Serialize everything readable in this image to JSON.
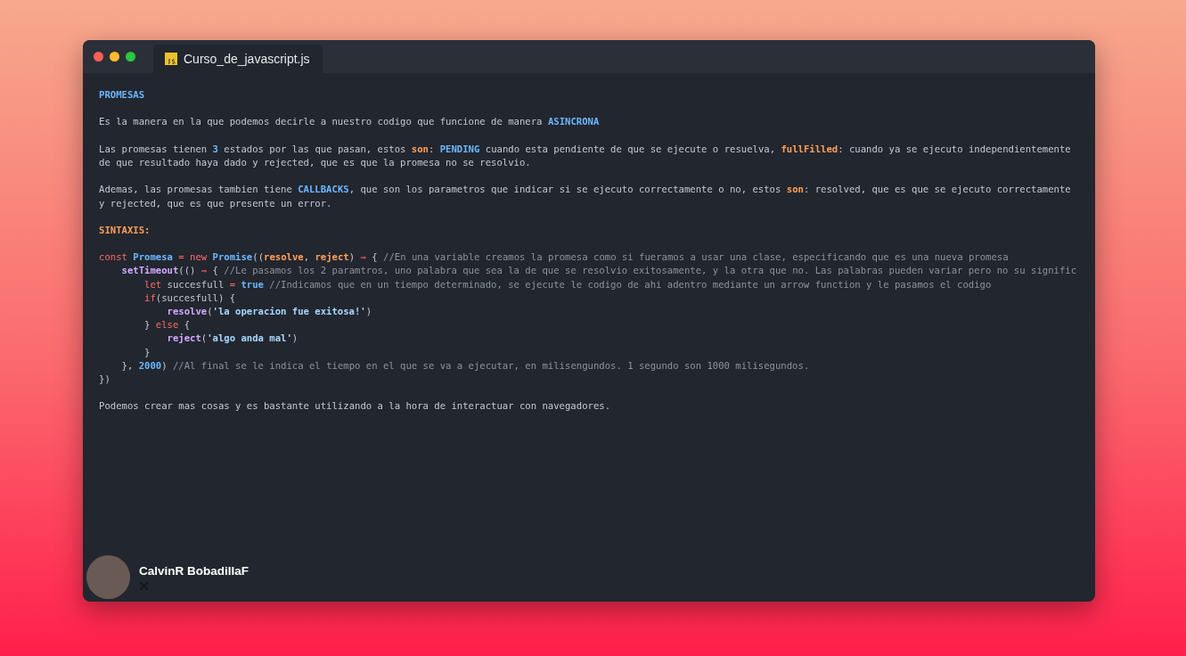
{
  "window": {
    "tab": {
      "label": "Curso_de_javascript.js",
      "selected": true
    }
  },
  "blocks": [
    {
      "lines": [
        [
          {
            "kind": "blue",
            "text": "PROMESAS"
          }
        ]
      ]
    },
    {
      "lines": [
        [
          {
            "kind": "plain",
            "text": "Es la manera en la que podemos decirle a nuestro codigo que funcione de manera "
          },
          {
            "kind": "blue",
            "text": "ASINCRONA"
          }
        ]
      ]
    },
    {
      "lines": [
        [
          {
            "kind": "plain",
            "text": "Las promesas tienen "
          },
          {
            "kind": "blue",
            "text": "3"
          },
          {
            "kind": "plain",
            "text": " estados por las que pasan, estos "
          },
          {
            "kind": "orange",
            "text": "son"
          },
          {
            "kind": "plain",
            "text": ": "
          },
          {
            "kind": "blue",
            "text": "PENDING"
          },
          {
            "kind": "plain",
            "text": " cuando esta pendiente de que se ejecute o resuelva, "
          },
          {
            "kind": "orange",
            "text": "fullFilled"
          },
          {
            "kind": "plain",
            "text": ": cuando ya se ejecuto independientemente"
          }
        ],
        [
          {
            "kind": "plain",
            "text": "de que resultado haya dado y rejected, que es que la promesa no se resolvio."
          }
        ]
      ]
    },
    {
      "lines": [
        [
          {
            "kind": "plain",
            "text": "Ademas, las promesas tambien tiene "
          },
          {
            "kind": "blue",
            "text": "CALLBACKS"
          },
          {
            "kind": "plain",
            "text": ", que son los parametros que indicar si se ejecuto correctamente o no, estos "
          },
          {
            "kind": "orange",
            "text": "son"
          },
          {
            "kind": "plain",
            "text": ": resolved, que es que se ejecuto correctamente"
          }
        ],
        [
          {
            "kind": "plain",
            "text": "y rejected, que es que presente un error."
          }
        ]
      ]
    },
    {
      "lines": [
        [
          {
            "kind": "orange",
            "text": "SINTAXIS:"
          }
        ]
      ]
    },
    {
      "code": [
        {
          "tokens": [
            {
              "kind": "keyword",
              "text": "const "
            },
            {
              "kind": "blue",
              "text": "Promesa"
            },
            {
              "kind": "keyword",
              "text": " = new "
            },
            {
              "kind": "blue",
              "text": "Promise"
            },
            {
              "kind": "plain",
              "text": "(("
            },
            {
              "kind": "orange",
              "text": "resolve"
            },
            {
              "kind": "plain",
              "text": ", "
            },
            {
              "kind": "orange",
              "text": "reject"
            },
            {
              "kind": "plain",
              "text": ") "
            },
            {
              "kind": "keyword",
              "text": "⇒"
            },
            {
              "kind": "plain",
              "text": " { "
            },
            {
              "kind": "comment",
              "text": "//En una variable creamos la promesa como si fueramos a usar una clase, especificando que es una nueva promesa"
            }
          ],
          "children": [
            {
              "tokens": [
                {
                  "kind": "func",
                  "text": "setTimeout"
                },
                {
                  "kind": "plain",
                  "text": "(() "
                },
                {
                  "kind": "keyword",
                  "text": "⇒"
                },
                {
                  "kind": "plain",
                  "text": " { "
                },
                {
                  "kind": "comment",
                  "text": "//Le pasamos los 2 paramtros, uno palabra que sea la de que se resolvio exitosamente, y la otra que no. Las palabras pueden variar pero no su signific"
                }
              ],
              "children": [
                {
                  "tokens": [
                    {
                      "kind": "keyword",
                      "text": "let "
                    },
                    {
                      "kind": "plain",
                      "text": "succesfull "
                    },
                    {
                      "kind": "keyword",
                      "text": "= "
                    },
                    {
                      "kind": "blue",
                      "text": "true "
                    },
                    {
                      "kind": "comment",
                      "text": "//Indicamos que en un tiempo determinado, se ejecute le codigo de ahi adentro mediante un arrow function y le pasamos el codigo"
                    }
                  ]
                },
                {
                  "tokens": [
                    {
                      "kind": "keyword",
                      "text": "if"
                    },
                    {
                      "kind": "plain",
                      "text": "(succesfull) {"
                    }
                  ],
                  "children": [
                    {
                      "tokens": [
                        {
                          "kind": "func",
                          "text": "resolve"
                        },
                        {
                          "kind": "plain",
                          "text": "("
                        },
                        {
                          "kind": "string",
                          "text": "'la operacion fue exitosa!'"
                        },
                        {
                          "kind": "plain",
                          "text": ")"
                        }
                      ]
                    }
                  ]
                },
                {
                  "tokens": [
                    {
                      "kind": "plain",
                      "text": "} "
                    },
                    {
                      "kind": "keyword",
                      "text": "else"
                    },
                    {
                      "kind": "plain",
                      "text": " {"
                    }
                  ],
                  "children": [
                    {
                      "tokens": [
                        {
                          "kind": "func",
                          "text": "reject"
                        },
                        {
                          "kind": "plain",
                          "text": "("
                        },
                        {
                          "kind": "string",
                          "text": "'algo anda mal'"
                        },
                        {
                          "kind": "plain",
                          "text": ")"
                        }
                      ]
                    }
                  ]
                },
                {
                  "tokens": [
                    {
                      "kind": "plain",
                      "text": "}"
                    }
                  ]
                }
              ]
            },
            {
              "tokens": [
                {
                  "kind": "plain",
                  "text": "}, "
                },
                {
                  "kind": "blue",
                  "text": "2000"
                },
                {
                  "kind": "plain",
                  "text": ") "
                },
                {
                  "kind": "comment",
                  "text": "//Al final se le indica el tiempo en el que se va a ejecutar, en milisengundos. 1 segundo son 1000 milisegundos."
                }
              ]
            }
          ]
        },
        {
          "tokens": [
            {
              "kind": "plain",
              "text": "})"
            }
          ]
        }
      ]
    },
    {
      "lines": [
        [
          {
            "kind": "plain",
            "text": "Podemos crear mas cosas y es bastante utilizando a la hora de interactuar con navegadores."
          }
        ]
      ]
    }
  ],
  "author": {
    "name": "CalvinR BobadillaF"
  }
}
